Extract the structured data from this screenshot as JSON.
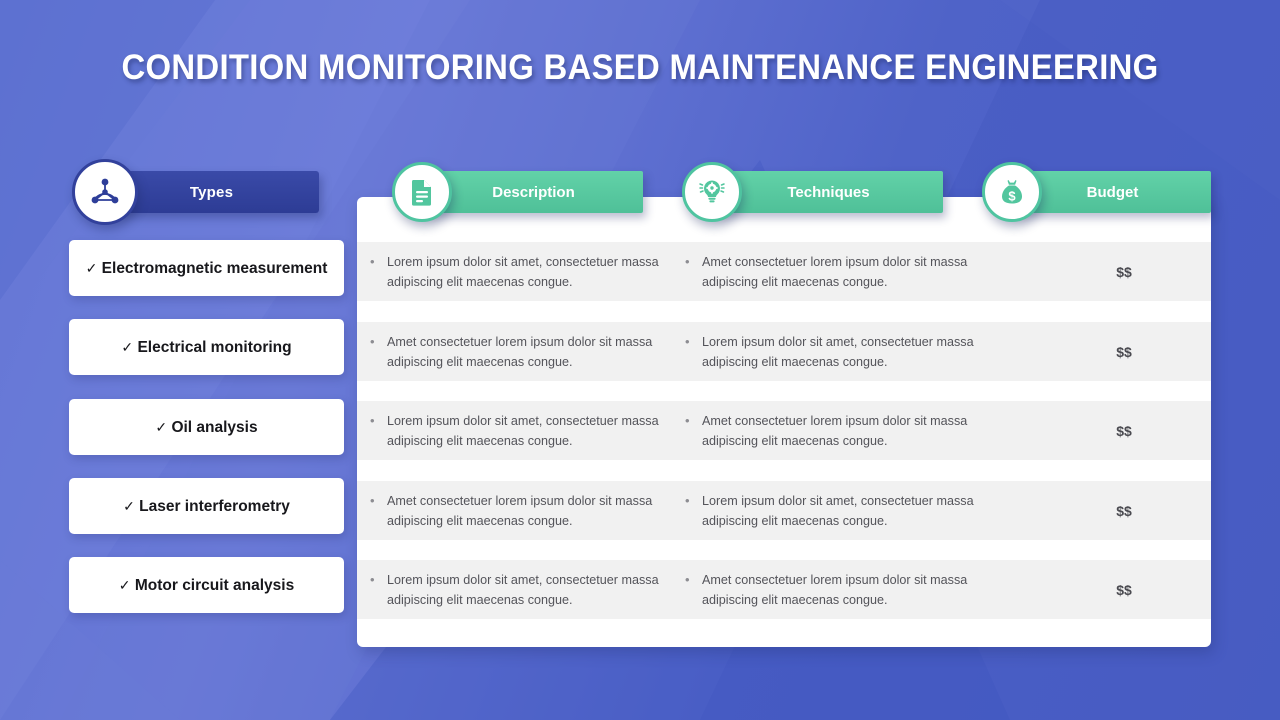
{
  "slide": {
    "title": "CONDITION MONITORING BASED MAINTENANCE ENGINEERING"
  },
  "colors": {
    "background_from": "#5b6fd0",
    "background_to": "#4a5fc4",
    "accent_green": "#57c9a0",
    "accent_blue": "#32419c",
    "row_gray": "#f1f1f1",
    "card_white": "#ffffff"
  },
  "sidebar": {
    "header": {
      "label": "Types",
      "icon": "network-nodes-icon"
    },
    "check_mark": "✓",
    "items": [
      {
        "label": "Electromagnetic measurement"
      },
      {
        "label": "Electrical monitoring"
      },
      {
        "label": "Oil analysis"
      },
      {
        "label": "Laser interferometry"
      },
      {
        "label": "Motor circuit analysis"
      }
    ]
  },
  "table": {
    "columns": [
      {
        "key": "description",
        "label": "Description",
        "icon": "document-icon"
      },
      {
        "key": "techniques",
        "label": "Techniques",
        "icon": "lightbulb-gear-icon"
      },
      {
        "key": "budget",
        "label": "Budget",
        "icon": "money-bag-icon"
      }
    ],
    "bullet": "•",
    "rows": [
      {
        "description": "Lorem ipsum dolor sit amet, consectetuer massa adipiscing elit maecenas congue.",
        "techniques": "Amet consectetuer lorem ipsum dolor sit massa adipiscing elit maecenas congue.",
        "budget": "$$"
      },
      {
        "description": "Amet consectetuer lorem ipsum dolor sit massa adipiscing elit maecenas congue.",
        "techniques": "Lorem ipsum dolor sit amet, consectetuer massa adipiscing elit maecenas congue.",
        "budget": "$$"
      },
      {
        "description": "Lorem ipsum dolor sit amet, consectetuer massa adipiscing elit maecenas congue.",
        "techniques": "Amet consectetuer lorem ipsum dolor sit massa adipiscing elit maecenas congue.",
        "budget": "$$"
      },
      {
        "description": "Amet consectetuer lorem ipsum dolor sit massa adipiscing elit maecenas congue.",
        "techniques": "Lorem ipsum dolor sit amet, consectetuer massa adipiscing elit maecenas congue.",
        "budget": "$$"
      },
      {
        "description": "Lorem ipsum dolor sit amet, consectetuer massa adipiscing elit maecenas congue.",
        "techniques": "Amet consectetuer lorem ipsum dolor sit massa adipiscing elit maecenas congue.",
        "budget": "$$"
      }
    ]
  }
}
